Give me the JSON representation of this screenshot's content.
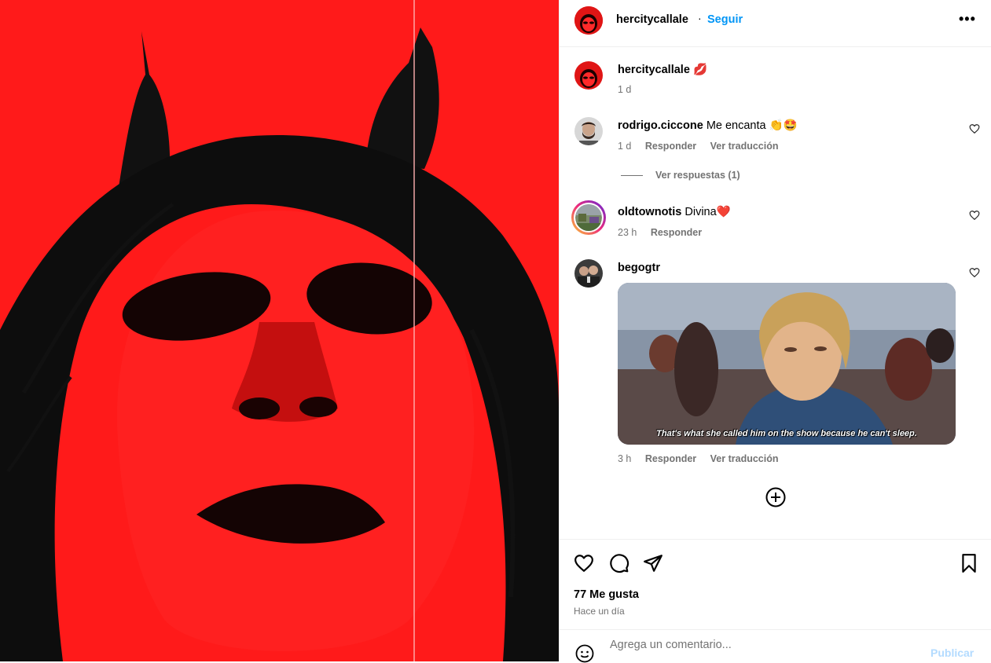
{
  "colors": {
    "accent": "#0095f6",
    "muted": "#737373",
    "media_red": "#ff1a1a"
  },
  "post": {
    "author": "hercitycallale",
    "follow_label": "Seguir",
    "separator": "·",
    "more_icon": "more-horizontal-icon"
  },
  "caption": {
    "username": "hercitycallale",
    "text": "💋",
    "time": "1 d"
  },
  "comments": [
    {
      "username": "rodrigo.ciccone",
      "text": "Me encanta 👏🤩",
      "time": "1 d",
      "reply_label": "Responder",
      "translate_label": "Ver traducción",
      "view_replies_label": "Ver respuestas (1)"
    },
    {
      "username": "oldtownotis",
      "text": "Divina❤️",
      "time": "23 h",
      "reply_label": "Responder"
    },
    {
      "username": "begogtr",
      "text": "",
      "gif_caption": "That's what she called him on the show because he can't sleep.",
      "time": "3 h",
      "reply_label": "Responder",
      "translate_label": "Ver traducción"
    }
  ],
  "actions": {
    "like_icon": "heart-icon",
    "comment_icon": "comment-icon",
    "share_icon": "send-icon",
    "save_icon": "bookmark-icon",
    "load_more_icon": "plus-circle-icon"
  },
  "likes_label": "77 Me gusta",
  "posted_ago": "Hace un día",
  "add_comment": {
    "placeholder": "Agrega un comentario...",
    "publish_label": "Publicar",
    "emoji_icon": "emoji-icon"
  }
}
